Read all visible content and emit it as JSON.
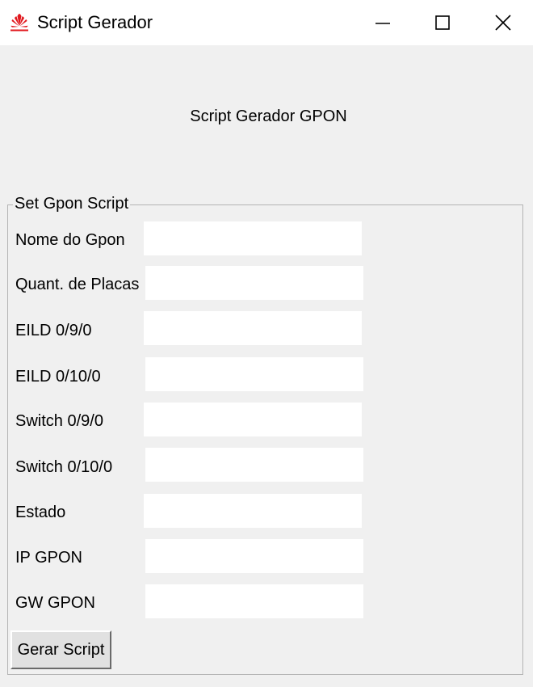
{
  "window": {
    "title": "Script Gerador",
    "icon": "huawei-logo-icon",
    "controls": [
      "minimize-icon",
      "maximize-icon",
      "close-icon"
    ]
  },
  "heading": "Script Gerador GPON",
  "group": {
    "legend": "Set Gpon Script",
    "fields": [
      {
        "label": "Nome do Gpon",
        "value": ""
      },
      {
        "label": "Quant. de Placas",
        "value": ""
      },
      {
        "label": "EILD 0/9/0",
        "value": ""
      },
      {
        "label": "EILD 0/10/0",
        "value": ""
      },
      {
        "label": "Switch 0/9/0",
        "value": ""
      },
      {
        "label": "Switch 0/10/0",
        "value": ""
      },
      {
        "label": "Estado",
        "value": ""
      },
      {
        "label": "IP GPON",
        "value": ""
      },
      {
        "label": "GW GPON",
        "value": ""
      }
    ]
  },
  "button": {
    "label": "Gerar Script"
  },
  "colors": {
    "background": "#f0f0f0",
    "titlebar": "#ffffff",
    "logo": "#e1181e"
  }
}
